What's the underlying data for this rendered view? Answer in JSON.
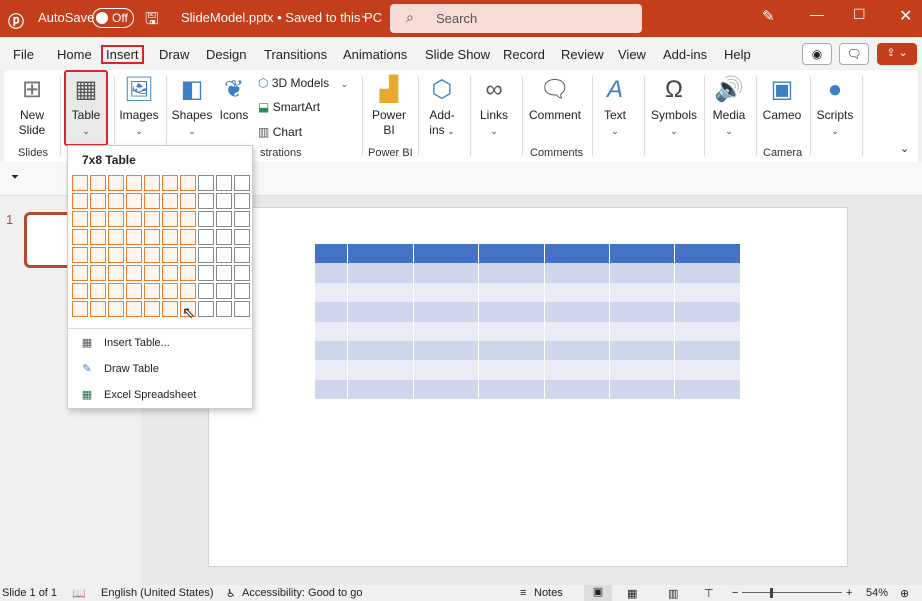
{
  "titlebar": {
    "autosave_label": "AutoSave",
    "autosave_state": "Off",
    "filename": "SlideModel.pptx • Saved to this PC",
    "search_placeholder": "Search",
    "accent": "#C43E1C"
  },
  "tabs": [
    "File",
    "Home",
    "Insert",
    "Draw",
    "Design",
    "Transitions",
    "Animations",
    "Slide Show",
    "Record",
    "Review",
    "View",
    "Add-ins",
    "Help"
  ],
  "active_tab": "Insert",
  "ribbon": {
    "new_slide": "New Slide",
    "table": "Table",
    "images": "Images",
    "shapes": "Shapes",
    "icons": "Icons",
    "models": "3D Models",
    "smartart": "SmartArt",
    "chart": "Chart",
    "power_bi": "Power BI",
    "addins": "Add-ins",
    "links": "Links",
    "comment": "Comment",
    "text": "Text",
    "symbols": "Symbols",
    "media": "Media",
    "cameo": "Cameo",
    "scripts": "Scripts",
    "groups": {
      "slides": "Slides",
      "illustrations": "strations",
      "power_bi": "Power BI",
      "comments": "Comments",
      "camera": "Camera"
    }
  },
  "table_menu": {
    "title": "7x8 Table",
    "grid_columns": 10,
    "grid_rows": 8,
    "selected_columns": 7,
    "selected_rows": 8,
    "items": [
      "Insert Table...",
      "Draw Table",
      "Excel Spreadsheet"
    ],
    "highlight": "#ED7D31"
  },
  "slides": {
    "number": "1"
  },
  "slide_table": {
    "columns": 7,
    "rows": 8,
    "header_color": "#4472C4",
    "band1": "#CFD5EA",
    "band2": "#E9EBF5"
  },
  "status": {
    "slide": "Slide 1 of 1",
    "language": "English (United States)",
    "accessibility": "Accessibility: Good to go",
    "notes": "Notes",
    "zoom": "54%"
  }
}
